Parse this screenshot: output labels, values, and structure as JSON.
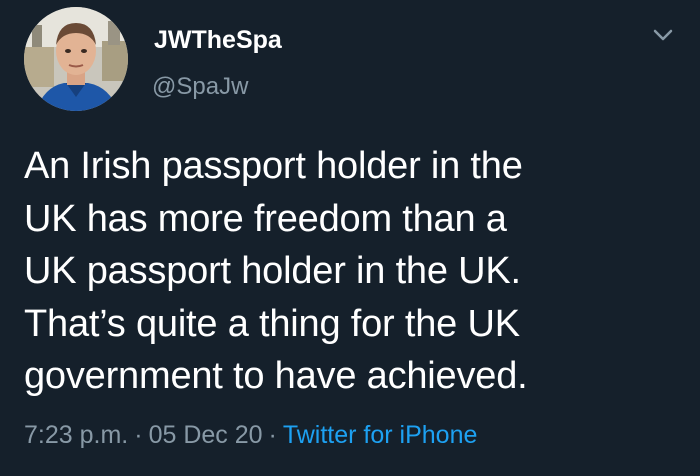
{
  "author": {
    "display_name": "JWTheSpa",
    "handle": "@SpaJw"
  },
  "tweet": {
    "lines": [
      "An Irish passport holder in the",
      "UK has more freedom than a",
      "UK passport holder in the UK.",
      "That’s quite a thing for the UK",
      "government to have achieved."
    ]
  },
  "meta": {
    "time": "7:23 p.m.",
    "separator": "·",
    "date": "05 Dec 20",
    "source": "Twitter for iPhone"
  },
  "icons": {
    "menu": "chevron-down-icon",
    "avatar": "profile-photo"
  },
  "colors": {
    "background": "#15202b",
    "secondary_text": "#8899a6",
    "link": "#1da1f2",
    "primary_text": "#ffffff"
  }
}
